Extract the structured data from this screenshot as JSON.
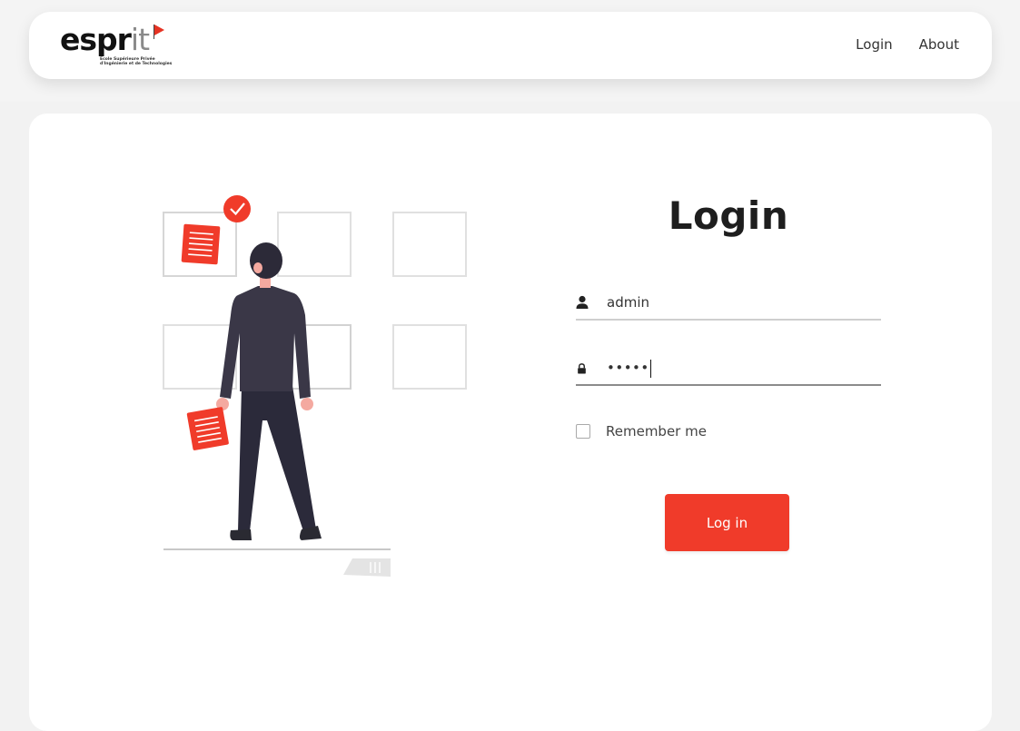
{
  "brand": {
    "name_main": "espr",
    "name_accent": "it",
    "tagline": "Ecole Supérieure Privée\nd'Ingénierie et de Technologies"
  },
  "nav": {
    "items": [
      {
        "label": "Login"
      },
      {
        "label": "About"
      }
    ]
  },
  "colors": {
    "accent": "#f03b2a",
    "figure": "#3a3747"
  },
  "login": {
    "title": "Login",
    "username": {
      "icon": "user-icon",
      "value": "admin"
    },
    "password": {
      "icon": "lock-icon",
      "masked_value": "•••••"
    },
    "remember_label": "Remember me",
    "remember_checked": false,
    "submit_label": "Log in"
  }
}
